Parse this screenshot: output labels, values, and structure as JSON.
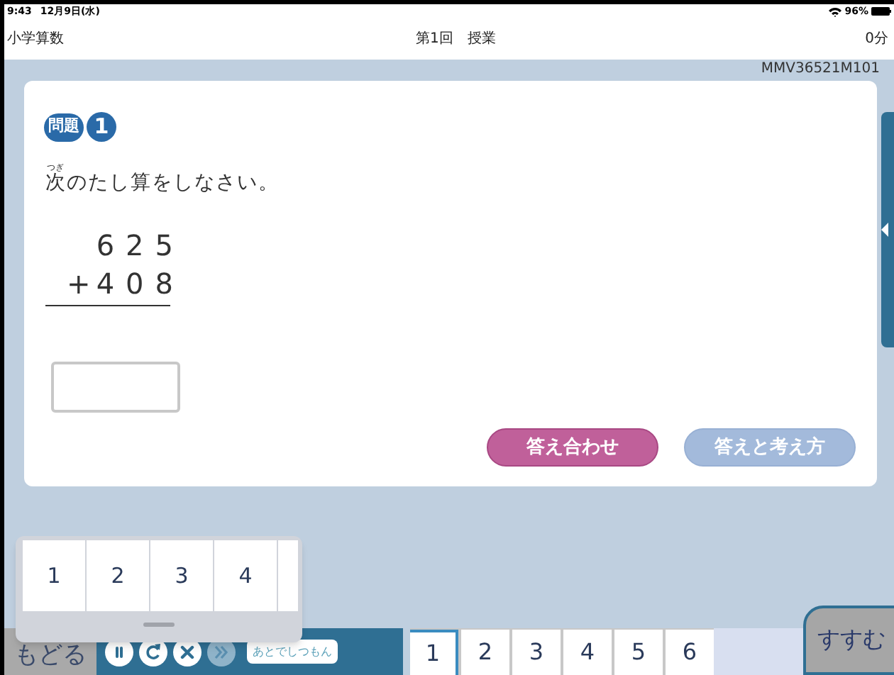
{
  "status_bar": {
    "time": "9:43",
    "date": "12月9日(水)",
    "battery": "96%"
  },
  "header": {
    "subject": "小学算数",
    "title": "第1回　授業",
    "elapsed": "0分"
  },
  "problem_code": "MMV36521M101",
  "question": {
    "badge_label": "問題",
    "number": "1",
    "ruby": "つぎ",
    "ruby_base": "次",
    "instruction": "のたし算をしなさい。",
    "addend": "625",
    "operator": "+",
    "operand": "408"
  },
  "buttons": [
    {
      "label": "答え合わせ",
      "disabled": false
    },
    {
      "label": "答えと考え方",
      "disabled": true
    }
  ],
  "popup": {
    "cells": [
      "1",
      "2",
      "3",
      "4"
    ]
  },
  "toolbar": {
    "back": "もどる",
    "controls": [
      {
        "kind": "pause",
        "disabled": false
      },
      {
        "kind": "redo",
        "disabled": false
      },
      {
        "kind": "close",
        "disabled": false
      },
      {
        "kind": "skip",
        "disabled": true
      }
    ],
    "ask_later": "あとでしつもん"
  },
  "question_tabs": [
    {
      "label": "1",
      "selected": true
    },
    {
      "label": "2",
      "selected": false
    },
    {
      "label": "3",
      "selected": false
    },
    {
      "label": "4",
      "selected": false
    },
    {
      "label": "5",
      "selected": false
    },
    {
      "label": "6",
      "selected": false
    }
  ],
  "next": "すすむ"
}
